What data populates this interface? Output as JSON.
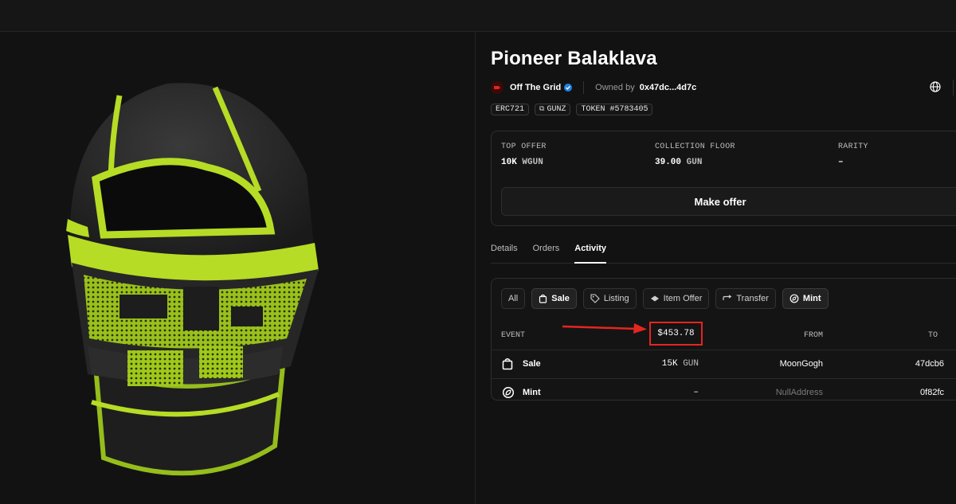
{
  "item": {
    "title": "Pioneer Balaklava",
    "collection_name": "Off The Grid",
    "owned_by_label": "Owned by",
    "owner": "0x47dc...4d7c"
  },
  "badges": [
    {
      "label": "ERC721"
    },
    {
      "label": "GUNZ"
    },
    {
      "label": "TOKEN #5783405"
    }
  ],
  "stats": {
    "top_offer_label": "TOP OFFER",
    "top_offer_value": "10K",
    "top_offer_unit": "WGUN",
    "floor_label": "COLLECTION FLOOR",
    "floor_value": "39.00",
    "floor_unit": "GUN",
    "rarity_label": "RARITY",
    "rarity_value": "–"
  },
  "actions": {
    "make_offer": "Make offer"
  },
  "tabs": [
    {
      "label": "Details",
      "active": false
    },
    {
      "label": "Orders",
      "active": false
    },
    {
      "label": "Activity",
      "active": true
    }
  ],
  "filters": [
    {
      "label": "All",
      "icon": "",
      "active": false
    },
    {
      "label": "Sale",
      "icon": "bag-icon",
      "active": true
    },
    {
      "label": "Listing",
      "icon": "tag-icon",
      "active": false
    },
    {
      "label": "Item Offer",
      "icon": "offer-icon",
      "active": false
    },
    {
      "label": "Transfer",
      "icon": "transfer-icon",
      "active": false
    },
    {
      "label": "Mint",
      "icon": "mint-icon",
      "active": true
    }
  ],
  "table": {
    "headers": {
      "event": "EVENT",
      "price": "$453.78",
      "from": "FROM",
      "to": "TO"
    },
    "rows": [
      {
        "event": "Sale",
        "icon": "bag-icon",
        "price": "15K",
        "unit": "GUN",
        "from": "MoonGogh",
        "to": "47dcb6"
      },
      {
        "event": "Mint",
        "icon": "mint-icon",
        "price": "–",
        "unit": "",
        "from": "NullAddress",
        "to": "0f82fc"
      }
    ]
  },
  "colors": {
    "background": "#121212",
    "accent_annotation": "#e3261f",
    "verified": "#2081e2",
    "mask_green": "#b6dc25"
  }
}
